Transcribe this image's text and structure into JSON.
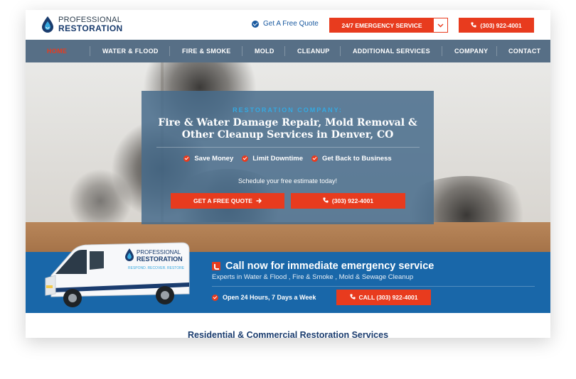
{
  "header": {
    "logo_line1": "PROFESSIONAL",
    "logo_line2": "RESTORATION",
    "quote_link": "Get A Free Quote",
    "emergency_label": "24/7 EMERGENCY SERVICE",
    "phone": "(303) 922-4001"
  },
  "nav": {
    "items": [
      "HOME",
      "WATER & FLOOD",
      "FIRE & SMOKE",
      "MOLD",
      "CLEANUP",
      "ADDITIONAL SERVICES",
      "COMPANY",
      "CONTACT"
    ],
    "active_index": 0
  },
  "hero": {
    "kicker": "RESTORATION COMPANY:",
    "title": "Fire & Water Damage Repair, Mold Removal & Other Cleanup Services in Denver, CO",
    "bullets": [
      "Save Money",
      "Limit Downtime",
      "Get Back to Business"
    ],
    "schedule": "Schedule your free estimate today!",
    "quote_button": "GET A FREE QUOTE",
    "phone_button": "(303) 922-4001"
  },
  "band": {
    "title": "Call now for immediate emergency service",
    "subtitle": "Experts in Water & Flood , Fire & Smoke , Mold & Sewage Cleanup",
    "hours": "Open 24 Hours, 7 Days a Week",
    "call_button": "CALL (303) 922-4001",
    "van_line1": "PROFESSIONAL",
    "van_line2": "RESTORATION",
    "van_tagline": "RESPOND. RECOVER. RESTORE"
  },
  "services": {
    "title": "Residential & Commercial Restoration Services"
  },
  "colors": {
    "accent": "#e83b1e",
    "nav_bg": "#576f86",
    "band_bg": "#1967a9",
    "brand_dark": "#1a3c6e",
    "kicker": "#35a8e0"
  },
  "icons": {
    "logo": "water-drop-icon",
    "check": "check-circle-icon",
    "phone": "phone-icon",
    "arrow": "arrow-right-icon",
    "caret": "chevron-down-icon"
  }
}
